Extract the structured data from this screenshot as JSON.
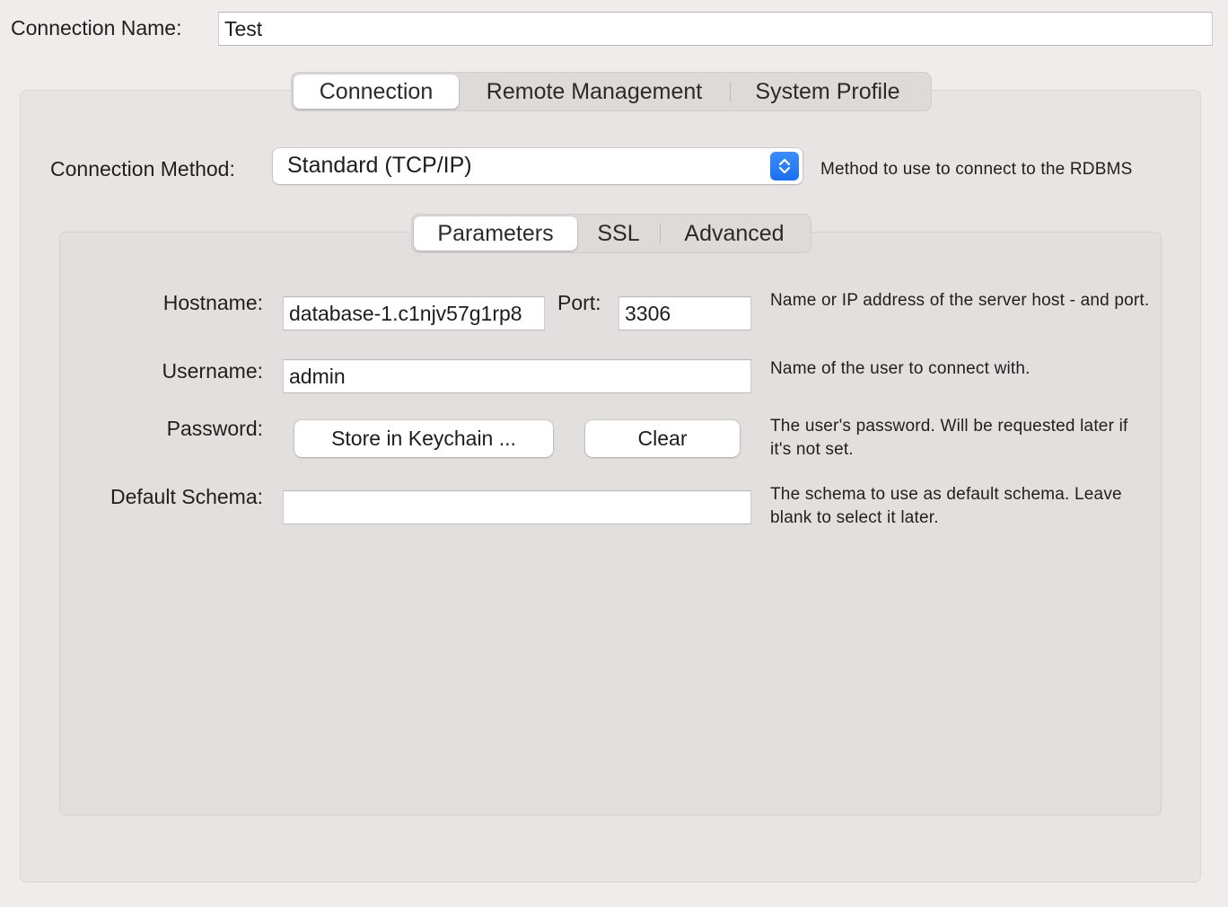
{
  "connection_name": {
    "label": "Connection Name:",
    "value": "Test"
  },
  "main_tabs": [
    {
      "label": "Connection",
      "active": true
    },
    {
      "label": "Remote Management",
      "active": false
    },
    {
      "label": "System Profile",
      "active": false
    }
  ],
  "connection_method": {
    "label": "Connection Method:",
    "value": "Standard (TCP/IP)",
    "help": "Method to use to connect to the RDBMS"
  },
  "sub_tabs": [
    {
      "label": "Parameters",
      "active": true
    },
    {
      "label": "SSL",
      "active": false
    },
    {
      "label": "Advanced",
      "active": false
    }
  ],
  "parameters": {
    "hostname": {
      "label": "Hostname:",
      "value": "database-1.c1njv57g1rp8",
      "help": "Name or IP address of the server host - and port."
    },
    "port": {
      "label": "Port:",
      "value": "3306"
    },
    "username": {
      "label": "Username:",
      "value": "admin",
      "help": "Name of the user to connect with."
    },
    "password": {
      "label": "Password:",
      "store_button": "Store in Keychain ...",
      "clear_button": "Clear",
      "help": "The user's password. Will be requested later if it's not set."
    },
    "default_schema": {
      "label": "Default Schema:",
      "value": "",
      "help": "The schema to use as default schema. Leave blank to select it later."
    }
  },
  "colors": {
    "window_bg": "#f1ecec",
    "accent": "#1a6ff2"
  },
  "icons": {
    "popup": "chevron-up-down-icon"
  }
}
